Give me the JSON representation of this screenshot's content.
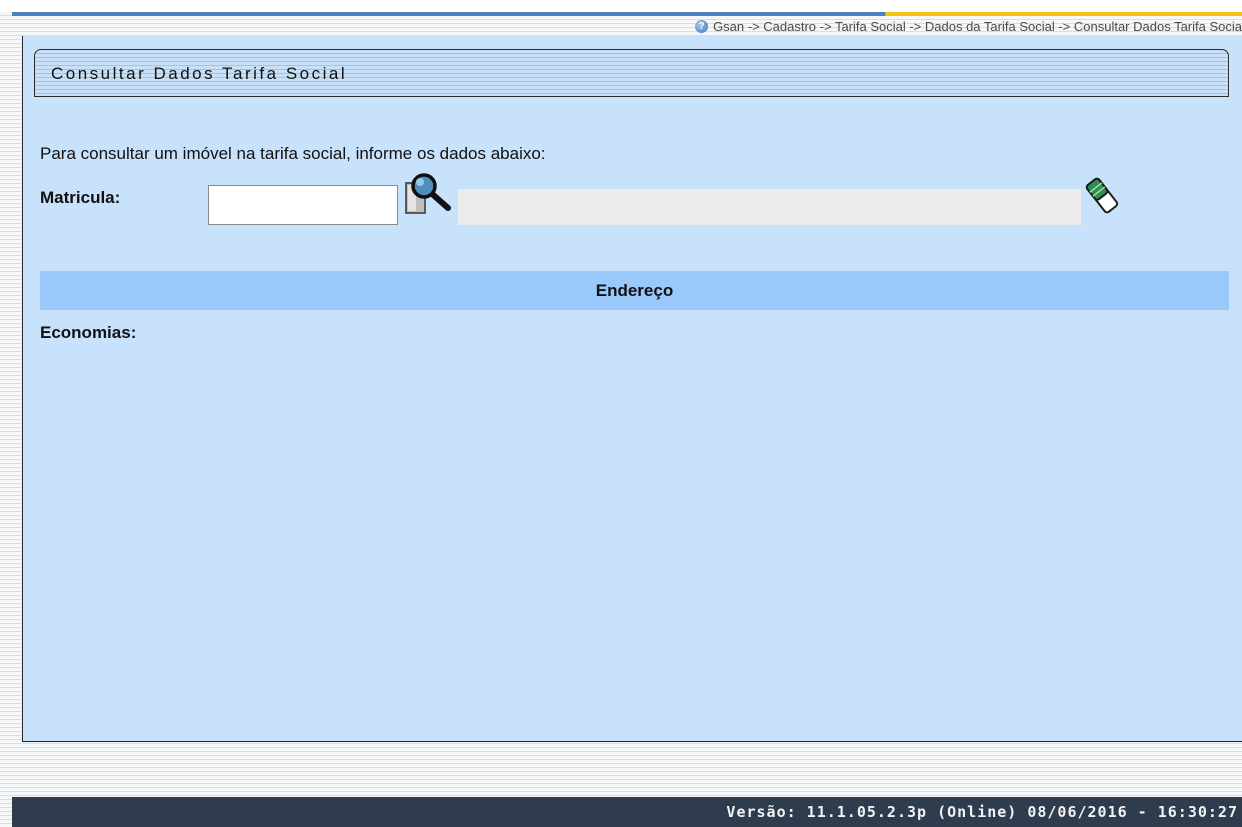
{
  "breadcrumb": {
    "help_icon": "help-icon",
    "text": "Gsan -> Cadastro -> Tarifa Social -> Dados da Tarifa Social -> Consultar Dados Tarifa Socia"
  },
  "header": {
    "title": "Consultar Dados Tarifa Social"
  },
  "form": {
    "instruction": "Para consultar um imóvel na tarifa social, informe os dados abaixo:",
    "matricula_label": "Matricula:",
    "matricula_value": "",
    "description_value": "",
    "search_icon": "magnifier-search-icon",
    "clear_icon": "eraser-icon"
  },
  "sections": {
    "endereco": "Endereço",
    "economias_label": "Economias:"
  },
  "footer": {
    "version": "Versão: 11.1.05.2.3p (Online) 08/06/2016 - 16:30:27"
  },
  "colors": {
    "panel_bg": "#c8e2fb",
    "section_bar": "#99c8fb",
    "footer_bg": "#2f3c4e",
    "accent_blue": "#4d82bf",
    "accent_yellow": "#f3c51a"
  }
}
